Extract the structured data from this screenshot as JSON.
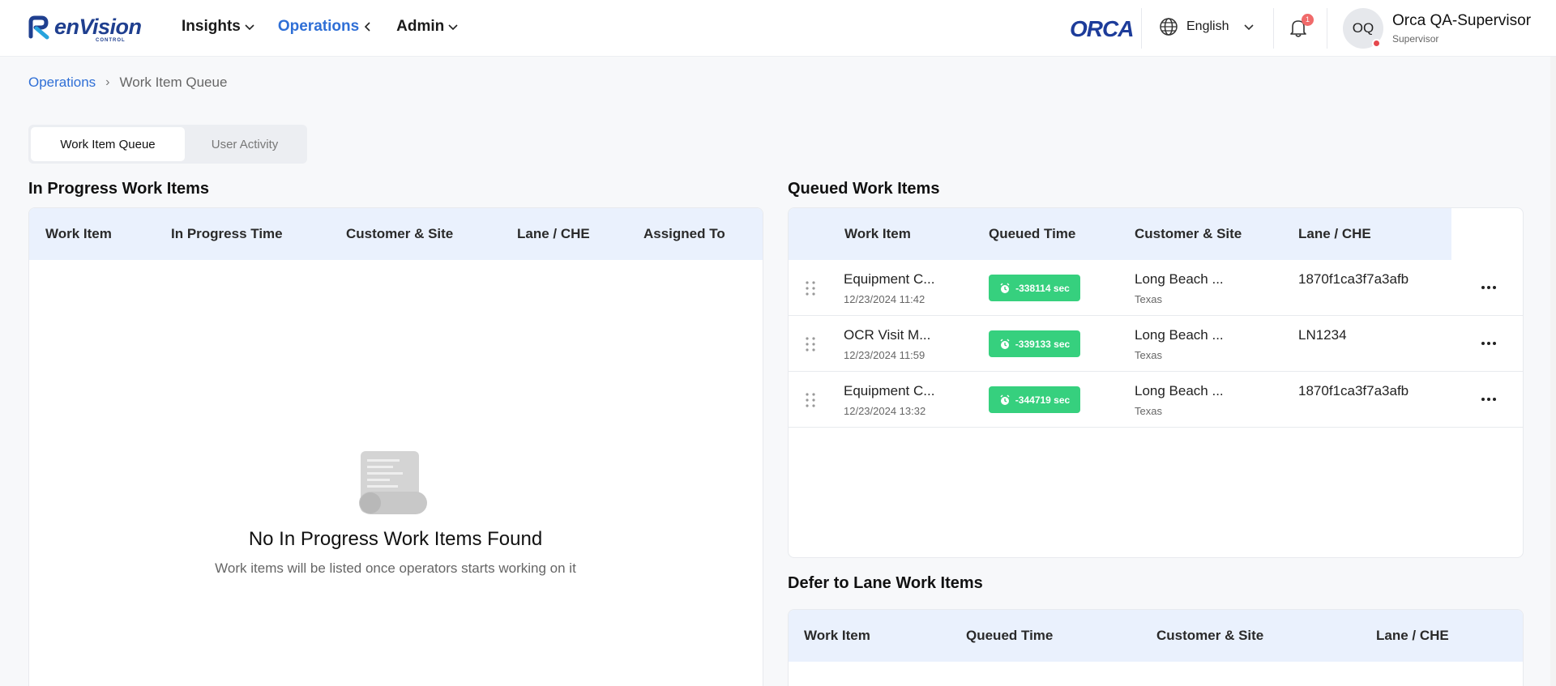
{
  "header": {
    "brand": "enVision",
    "brand_sub": "CONTROL",
    "nav": [
      "Insights",
      "Operations",
      "Admin"
    ],
    "orca_logo": "ORCA",
    "language": "English",
    "notification_count": "1",
    "avatar_initials": "OQ",
    "user_name": "Orca QA-Supervisor",
    "user_role": "Supervisor"
  },
  "breadcrumb": {
    "parent": "Operations",
    "current": "Work Item Queue"
  },
  "tabs": [
    "Work Item Queue",
    "User Activity"
  ],
  "in_progress": {
    "title": "In Progress Work Items",
    "columns": [
      "Work Item",
      "In Progress Time",
      "Customer & Site",
      "Lane / CHE",
      "Assigned To"
    ],
    "empty_title": "No In Progress Work Items Found",
    "empty_sub": "Work items will be listed once operators starts working on it"
  },
  "queued": {
    "title": "Queued Work Items",
    "columns": [
      "Work Item",
      "Queued Time",
      "Customer & Site",
      "Lane / CHE"
    ],
    "rows": [
      {
        "name": "Equipment C...",
        "date": "12/23/2024 11:42",
        "timer": "-338114 sec",
        "site": "Long Beach ...",
        "region": "Texas",
        "lane": "1870f1ca3f7a3afb"
      },
      {
        "name": "OCR Visit M...",
        "date": "12/23/2024 11:59",
        "timer": "-339133 sec",
        "site": "Long Beach ...",
        "region": "Texas",
        "lane": "LN1234"
      },
      {
        "name": "Equipment C...",
        "date": "12/23/2024 13:32",
        "timer": "-344719 sec",
        "site": "Long Beach ...",
        "region": "Texas",
        "lane": "1870f1ca3f7a3afb"
      }
    ]
  },
  "defer": {
    "title": "Defer to Lane Work Items",
    "columns": [
      "Work Item",
      "Queued Time",
      "Customer & Site",
      "Lane / CHE"
    ]
  },
  "colors": {
    "accent": "#2f6fd6",
    "timer_green": "#36d07e",
    "table_header": "#eaf1fd",
    "badge_red": "#f06a6a"
  }
}
